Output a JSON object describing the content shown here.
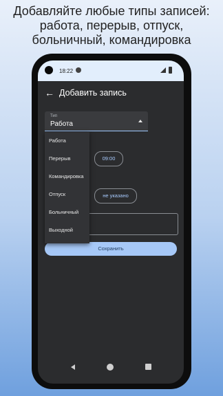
{
  "promo": {
    "line1": "Добавляйте любые типы записей:",
    "line2": "работа, перерыв, отпуск,",
    "line3": "больничный, командировка"
  },
  "status_bar": {
    "time": "18:22"
  },
  "app_bar": {
    "title": "Добавить запись",
    "back_icon": "arrow-left-icon"
  },
  "type_field": {
    "label": "Тип",
    "value": "Работа"
  },
  "dropdown": {
    "options": [
      "Работа",
      "Перерыв",
      "Командировка",
      "Отпуск",
      "Больничный",
      "Выходной"
    ]
  },
  "time_chip": "09:00",
  "not_specified_chip": "не указано",
  "save_button": "Сохранить",
  "colors": {
    "accent": "#a8cbff",
    "button_bg": "#a6c8f7",
    "screen_bg": "#2b2c2e",
    "status_bar_bg": "#e2eefc"
  }
}
